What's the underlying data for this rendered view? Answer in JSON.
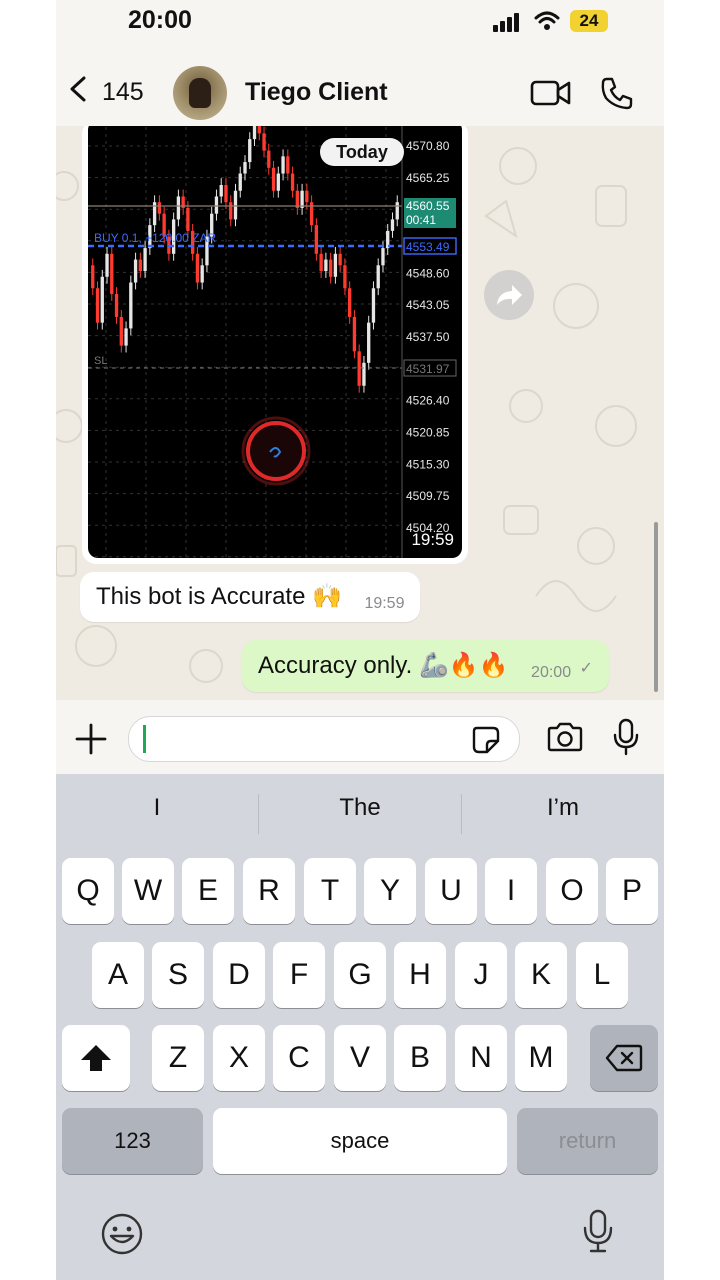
{
  "status_bar": {
    "time": "20:00",
    "battery": "24"
  },
  "header": {
    "back_count": "145",
    "contact_name": "Tiego Client"
  },
  "chart": {
    "date_badge": "Today",
    "price_labels": [
      "4570.80",
      "4565.25",
      "4548.60",
      "4543.05",
      "4537.50",
      "4526.40",
      "4520.85",
      "4515.30",
      "4509.75",
      "4504.20"
    ],
    "current_price": "4560.55",
    "current_countdown": "00:41",
    "buy_price": "4553.49",
    "sl_price": "4531.97",
    "buy_label": "BUY 0.1, +120.00 ZAR",
    "sl_label": "SL",
    "colors": {
      "bull": "#e6e6e6",
      "bear": "#ff3b30",
      "buy_line": "#3d6bff",
      "bg": "#000000"
    }
  },
  "messages": [
    {
      "direction": "in",
      "type": "image",
      "time": "19:59"
    },
    {
      "direction": "in",
      "type": "text",
      "text": "This bot is Accurate 🙌",
      "time": "19:59"
    },
    {
      "direction": "out",
      "type": "text",
      "text": "Accuracy only. 🦾🔥🔥",
      "time": "20:00",
      "status_icon": "✓"
    }
  ],
  "keyboard": {
    "suggestions": [
      "I",
      "The",
      "I’m"
    ],
    "row1": [
      "Q",
      "W",
      "E",
      "R",
      "T",
      "Y",
      "U",
      "I",
      "O",
      "P"
    ],
    "row2": [
      "A",
      "S",
      "D",
      "F",
      "G",
      "H",
      "J",
      "K",
      "L"
    ],
    "row3": [
      "Z",
      "X",
      "C",
      "V",
      "B",
      "N",
      "M"
    ],
    "numbers_label": "123",
    "space_label": "space",
    "return_label": "return"
  },
  "icons": [
    "back-icon",
    "video-icon",
    "phone-icon",
    "forward-icon",
    "plus-icon",
    "sticker-icon",
    "camera-icon",
    "mic-icon",
    "shift-icon",
    "backspace-icon",
    "emoji-icon"
  ]
}
